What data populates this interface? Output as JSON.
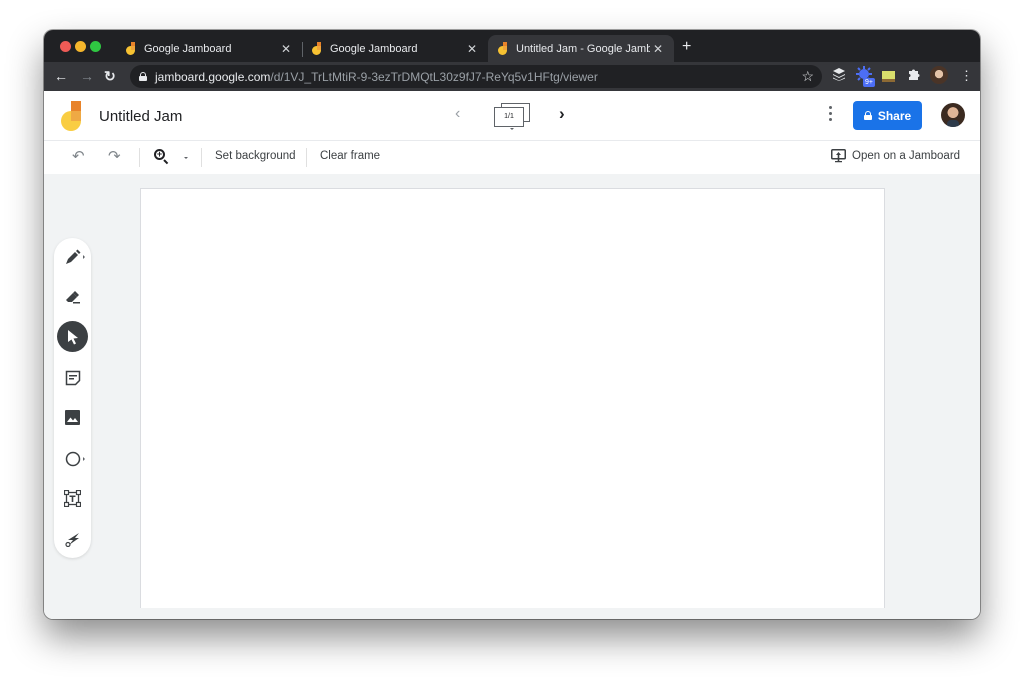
{
  "browser": {
    "tabs": [
      {
        "title": "Google Jamboard",
        "active": false
      },
      {
        "title": "Google Jamboard",
        "active": false
      },
      {
        "title": "Untitled Jam - Google Jamboard",
        "active": true
      }
    ],
    "new_tab_label": "+",
    "close_glyph": "✕",
    "nav": {
      "back": "←",
      "forward": "→",
      "reload": "↻"
    },
    "url": {
      "host": "jamboard.google.com",
      "path": "/d/1VJ_TrLtMtiR-9-3ezTrDMQtL30z9fJ7-ReYq5v1HFtg/viewer"
    },
    "bookmark_icon": "☆",
    "extensions": [
      {
        "name": "layers-extension-icon",
        "glyph": "≋"
      },
      {
        "name": "badge-extension-icon",
        "badge": "9+"
      },
      {
        "name": "screen-extension-icon",
        "glyph": "▬"
      },
      {
        "name": "puzzle-extensions-icon",
        "glyph": "✱"
      },
      {
        "name": "profile-avatar-icon",
        "glyph": ""
      },
      {
        "name": "chrome-menu-icon",
        "glyph": "⋮"
      }
    ],
    "accent_badge_color": "#4c6ef5"
  },
  "app": {
    "title": "Untitled Jam",
    "frame_indicator": "1/1",
    "prev_glyph": "‹",
    "next_glyph": "›",
    "share_label": "Share",
    "brand_color": "#1a73e8"
  },
  "subtoolbar": {
    "undo_glyph": "↶",
    "redo_glyph": "↷",
    "set_background_label": "Set background",
    "clear_frame_label": "Clear frame",
    "open_on_jamboard_label": "Open on a Jamboard"
  },
  "tools": [
    {
      "name": "pen",
      "active": false,
      "has_submenu": true
    },
    {
      "name": "eraser",
      "active": false,
      "has_submenu": false
    },
    {
      "name": "select",
      "active": true,
      "has_submenu": false
    },
    {
      "name": "sticky-note",
      "active": false,
      "has_submenu": false
    },
    {
      "name": "add-image",
      "active": false,
      "has_submenu": false
    },
    {
      "name": "circle",
      "active": false,
      "has_submenu": true
    },
    {
      "name": "text-box",
      "active": false,
      "has_submenu": false
    },
    {
      "name": "laser",
      "active": false,
      "has_submenu": false
    }
  ]
}
